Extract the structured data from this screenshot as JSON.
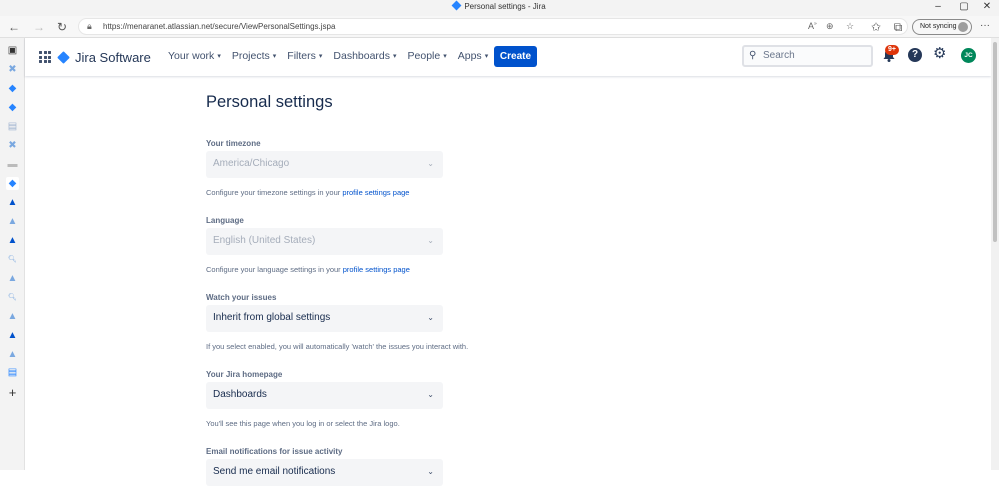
{
  "browser": {
    "window_title": "Personal settings - Jira",
    "url": "https://menaranet.atlassian.net/secure/ViewPersonalSettings.jspa",
    "sync_label": "Not syncing"
  },
  "header": {
    "product": "Jira Software",
    "nav": [
      {
        "label": "Your work"
      },
      {
        "label": "Projects"
      },
      {
        "label": "Filters"
      },
      {
        "label": "Dashboards"
      },
      {
        "label": "People"
      },
      {
        "label": "Apps"
      }
    ],
    "create_label": "Create",
    "search_placeholder": "Search",
    "notification_badge": "9+",
    "help_glyph": "?",
    "avatar_initials": "JC"
  },
  "page": {
    "title": "Personal settings",
    "fields": [
      {
        "label": "Your timezone",
        "value": "America/Chicago",
        "disabled": true,
        "help_prefix": "Configure your timezone settings in your ",
        "help_link": "profile settings page",
        "help_suffix": ""
      },
      {
        "label": "Language",
        "value": "English (United States)",
        "disabled": true,
        "help_prefix": "Configure your language settings in your ",
        "help_link": "profile settings page",
        "help_suffix": ""
      },
      {
        "label": "Watch your issues",
        "value": "Inherit from global settings",
        "disabled": false,
        "help_prefix": "If you select enabled, you will automatically 'watch' the issues you interact with.",
        "help_link": "",
        "help_suffix": ""
      },
      {
        "label": "Your Jira homepage",
        "value": "Dashboards",
        "disabled": false,
        "help_prefix": "You'll see this page when you log in or select the Jira logo.",
        "help_link": "",
        "help_suffix": ""
      },
      {
        "label": "Email notifications for issue activity",
        "value": "Send me email notifications",
        "disabled": false,
        "help_prefix": "",
        "help_link": "",
        "help_suffix": ""
      }
    ]
  },
  "colors": {
    "brand": "#0052cc",
    "jira_blue": "#2684ff",
    "badge_red": "#de350b",
    "avatar_green": "#00875a"
  },
  "icons": [
    "back-arrow-icon",
    "forward-arrow-icon",
    "refresh-icon",
    "lock-icon",
    "read-aloud-icon",
    "zoom-icon",
    "favorite-icon",
    "favorites-icon",
    "collections-icon",
    "more-icon",
    "app-switcher-icon",
    "jira-logo-icon",
    "search-icon",
    "bell-icon",
    "help-icon",
    "gear-icon",
    "chevron-down-icon"
  ]
}
